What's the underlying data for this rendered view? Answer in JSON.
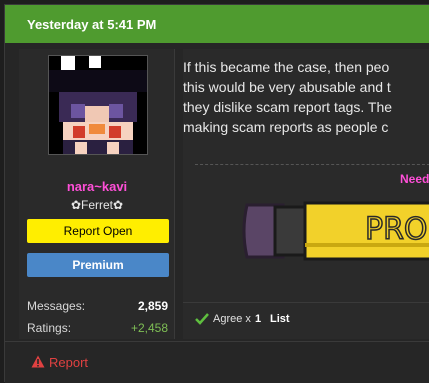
{
  "post": {
    "date": "Yesterday at 5:41 PM",
    "body_lines": [
      "If this became the case, then peo",
      "this would be very abusable and t",
      "they dislike scam report tags. The",
      "making scam reports as people c"
    ],
    "signature_text": "Need",
    "signature_banner_text": "PROF"
  },
  "user": {
    "name": "nara~kavi",
    "title": "✿Ferret✿",
    "badge_report": "Report Open",
    "badge_premium": "Premium",
    "stats": {
      "messages_label": "Messages:",
      "messages_value": "2,859",
      "ratings_label": "Ratings:",
      "ratings_value": "+2,458"
    }
  },
  "reactions": {
    "agree_label": "Agree x",
    "agree_count": "1",
    "list_label": "List"
  },
  "footer": {
    "report_label": "Report"
  },
  "colors": {
    "header_green": "#4f9b2f",
    "username_pink": "#ff4fd8",
    "badge_yellow": "#ffee00",
    "badge_blue": "#4a87c8",
    "ratings_green": "#7fbf55",
    "report_red": "#e04141"
  },
  "icons": {
    "agree": "checkmark-icon",
    "report": "warning-triangle-icon"
  }
}
